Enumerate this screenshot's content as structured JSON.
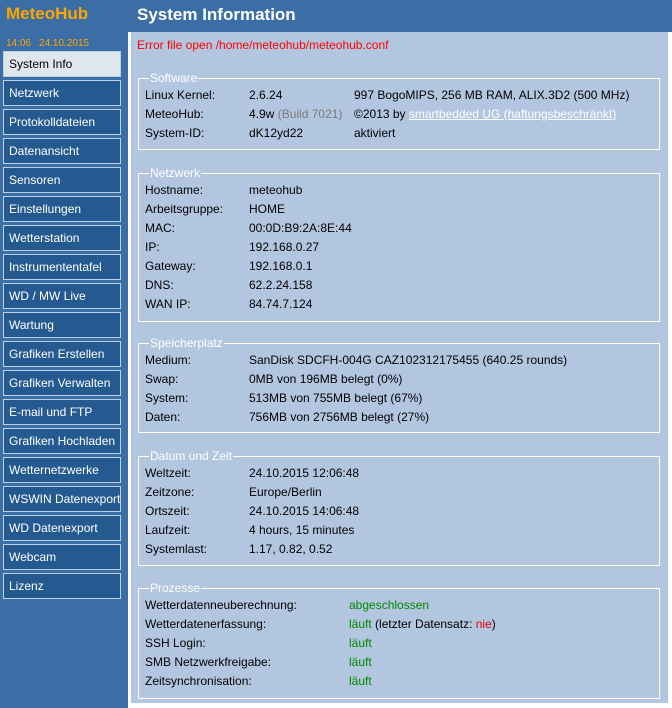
{
  "app": {
    "name": "MeteoHub",
    "time": "14:06",
    "date": "24.10.2015"
  },
  "nav": {
    "items": [
      {
        "label": "System Info"
      },
      {
        "label": "Netzwerk"
      },
      {
        "label": "Protokolldateien"
      },
      {
        "label": "Datenansicht"
      },
      {
        "label": "Sensoren"
      },
      {
        "label": "Einstellungen"
      },
      {
        "label": "Wetterstation"
      },
      {
        "label": "Instrumententafel"
      },
      {
        "label": "WD / MW Live"
      },
      {
        "label": "Wartung"
      },
      {
        "label": "Grafiken Erstellen"
      },
      {
        "label": "Grafiken Verwalten"
      },
      {
        "label": "E-mail und FTP"
      },
      {
        "label": "Grafiken Hochladen"
      },
      {
        "label": "Wetternetzwerke"
      },
      {
        "label": "WSWIN Datenexport"
      },
      {
        "label": "WD Datenexport"
      },
      {
        "label": "Webcam"
      },
      {
        "label": "Lizenz"
      }
    ]
  },
  "page": {
    "title": "System Information",
    "error": "Error file open /home/meteohub/meteohub.conf"
  },
  "software": {
    "legend": "Software",
    "kernel_label": "Linux Kernel:",
    "kernel_value": "2.6.24",
    "kernel_info": "997 BogoMIPS, 256 MB RAM, ALIX.3D2 (500 MHz)",
    "meteohub_label": "MeteoHub:",
    "meteohub_version": "4.9w",
    "meteohub_build": "(Build 7021)",
    "copyright_prefix": "©2013 by",
    "copyright_link": "smartbedded UG (haftungsbeschränkt)",
    "sysid_label": "System-ID:",
    "sysid_value": "dK12yd22",
    "sysid_status": "aktiviert"
  },
  "network": {
    "legend": "Netzwerk",
    "rows": [
      {
        "label": "Hostname:",
        "value": "meteohub"
      },
      {
        "label": "Arbeitsgruppe:",
        "value": "HOME"
      },
      {
        "label": "MAC:",
        "value": "00:0D:B9:2A:8E:44"
      },
      {
        "label": "IP:",
        "value": "192.168.0.27"
      },
      {
        "label": "Gateway:",
        "value": "192.168.0.1"
      },
      {
        "label": "DNS:",
        "value": "62.2.24.158"
      },
      {
        "label": "WAN IP:",
        "value": "84.74.7.124"
      }
    ]
  },
  "storage": {
    "legend": "Speicherplatz",
    "rows": [
      {
        "label": "Medium:",
        "value": "SanDisk SDCFH-004G CAZ102312175455 (640.25 rounds)"
      },
      {
        "label": "Swap:",
        "value": "0MB von 196MB belegt (0%)"
      },
      {
        "label": "System:",
        "value": "513MB von 755MB belegt (67%)"
      },
      {
        "label": "Daten:",
        "value": "756MB von 2756MB belegt (27%)"
      }
    ]
  },
  "datetime": {
    "legend": "Datum und Zeit",
    "rows": [
      {
        "label": "Weltzeit:",
        "value": "24.10.2015 12:06:48"
      },
      {
        "label": "Zeitzone:",
        "value": "Europe/Berlin"
      },
      {
        "label": "Ortszeit:",
        "value": "24.10.2015 14:06:48"
      },
      {
        "label": "Laufzeit:",
        "value": "4 hours, 15 minutes"
      },
      {
        "label": "Systemlast:",
        "value": "1.17, 0.82, 0.52"
      }
    ]
  },
  "processes": {
    "legend": "Prozesse",
    "rows": [
      {
        "label": "Wetterdatenneuberechnung:",
        "status": "abgeschlossen"
      },
      {
        "label": "Wetterdatenerfassung:",
        "status": "läuft",
        "note_prefix": "(letzter Datensatz:",
        "note_value": "nie",
        "note_suffix": ")"
      },
      {
        "label": "SSH Login:",
        "status": "läuft"
      },
      {
        "label": "SMB Netzwerkfreigabe:",
        "status": "läuft"
      },
      {
        "label": "Zeitsynchronisation:",
        "status": "läuft"
      }
    ]
  },
  "colors": {
    "sidebar": "#3a6ea5",
    "content": "#b3c6e0",
    "accent": "#ffa500",
    "error": "#ff0000",
    "ok": "#008800"
  }
}
